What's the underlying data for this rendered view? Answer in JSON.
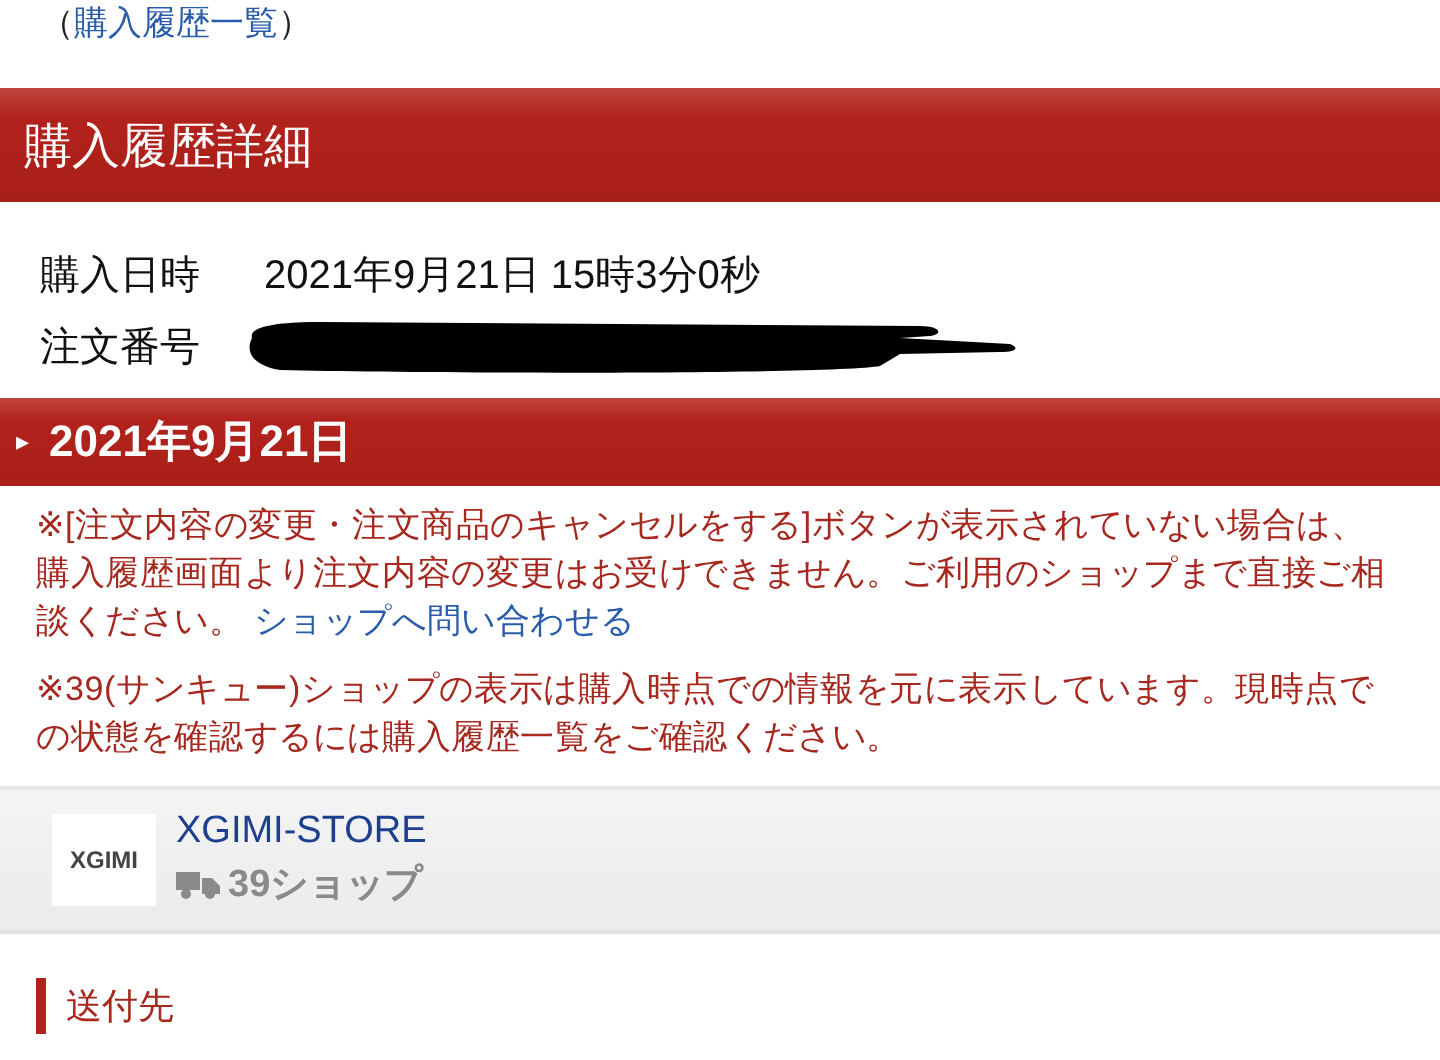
{
  "back_link": {
    "open": "（",
    "label": "購入履歴一覧",
    "close": "）"
  },
  "page_title": "購入履歴詳細",
  "details": [
    {
      "label": "購入日時",
      "value": "2021年9月21日 15時3分0秒"
    },
    {
      "label": "注文番号",
      "kind": "redacted"
    }
  ],
  "section": {
    "marker": "▸",
    "title": "2021年9月21日"
  },
  "notes": [
    {
      "text": "※[注文内容の変更・注文商品のキャンセルをする]ボタンが表示されていない場合は、購入履歴画面より注文内容の変更はお受けできません。ご利用のショップまで直接ご相談ください。",
      "link": "ショップへ問い合わせる"
    },
    {
      "text": "※39(サンキュー)ショップの表示は購入時点での情報を元に表示しています。現時点での状態を確認するには購入履歴一覧をご確認ください。"
    }
  ],
  "shop": {
    "logo": "XGIMI",
    "name": "XGIMI-STORE",
    "badge": "39ショップ"
  },
  "subsection": "送付先"
}
